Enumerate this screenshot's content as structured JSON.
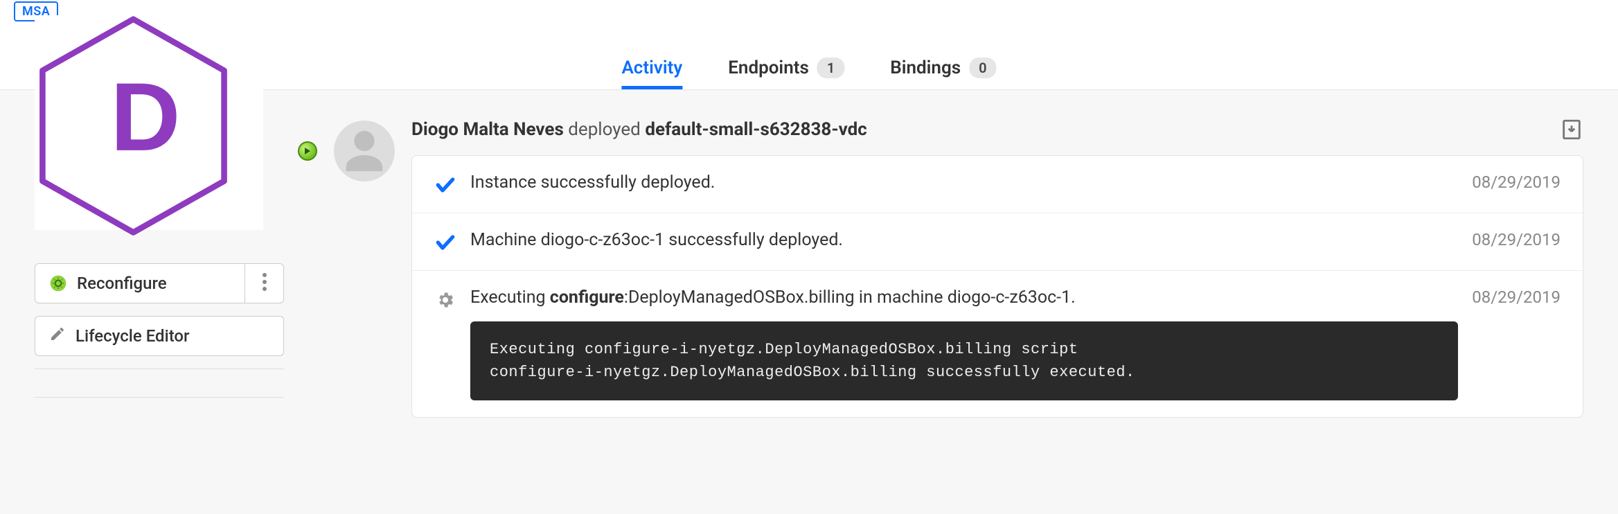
{
  "badge": "MSA",
  "hexLetter": "D",
  "tabs": {
    "activity": {
      "label": "Activity"
    },
    "endpoints": {
      "label": "Endpoints",
      "count": "1"
    },
    "bindings": {
      "label": "Bindings",
      "count": "0"
    }
  },
  "sidebar": {
    "reconfigure": "Reconfigure",
    "lifecycle": "Lifecycle Editor"
  },
  "activity": {
    "user": "Diogo Malta Neves",
    "verb": "deployed",
    "target": "default-small-s632838-vdc",
    "rows": [
      {
        "type": "check",
        "text": "Instance successfully deployed.",
        "date": "08/29/2019"
      },
      {
        "type": "check",
        "text": "Machine diogo-c-z63oc-1 successfully deployed.",
        "date": "08/29/2019"
      },
      {
        "type": "cog",
        "prefix": "Executing ",
        "bold": "configure",
        "suffix": ":DeployManagedOSBox.billing in machine diogo-c-z63oc-1.",
        "date": "08/29/2019",
        "terminal": "Executing configure-i-nyetgz.DeployManagedOSBox.billing script\nconfigure-i-nyetgz.DeployManagedOSBox.billing successfully executed."
      }
    ]
  }
}
